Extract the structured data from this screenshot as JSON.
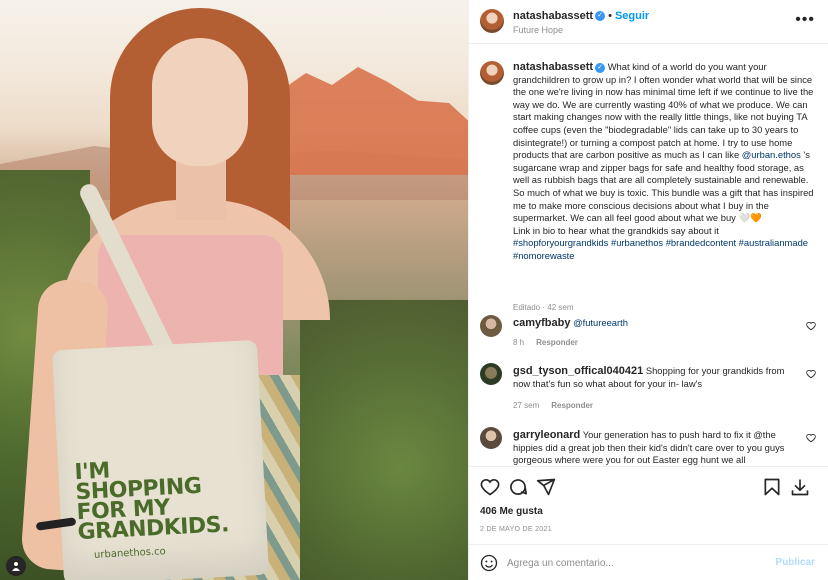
{
  "post": {
    "username": "natashabassett",
    "verified_mark": "✓",
    "follow_label": "Seguir",
    "location": "Future Hope",
    "more_label": "•••"
  },
  "photo": {
    "bag_lines": [
      "I'M",
      "SHOPPING",
      "FOR MY",
      "GRANDKIDS."
    ],
    "bag_brand": "urbanethos.co",
    "corner_icon": "user-tag-icon"
  },
  "caption": {
    "username": "natashabassett",
    "text_1": "What kind of a world do you want your grandchildren to grow up in? I often wonder what world that will be since the one we're living in now has minimal time left if we continue to live the way we do. We are currently wasting 40% of what we produce. We can start making changes now with the really little things, like not buying TA coffee cups (even the \"biodegradable\" lids can take up to 30 years to disintegrate!) or turning a compost patch at home. I try to use home products that are carbon positive as much as I can like ",
    "mention": "@urban.ethos",
    "text_2": " 's sugarcane wrap and zipper bags for safe and healthy food storage, as well as rubbish bags that are all completely sustainable and renewable. So much of what we buy is toxic. This bundle was a gift that has inspired me to make more conscious decisions about what I buy in the supermarket. We can all feel good about what we buy ",
    "emoji": "🤍🧡",
    "text_3": " Link in bio to hear what the grandkids say about it",
    "hashtags": "#shopforyourgrandkids #urbanethos #brandedcontent #australianmade #nomorewaste",
    "meta": "Editado · 42 sem"
  },
  "comments": [
    {
      "username": "camyfbaby",
      "text": "@futureearth",
      "time": "8 h",
      "reply": "Responder"
    },
    {
      "username": "gsd_tyson_offical040421",
      "text": "Shopping for your grandkids from now that's fun so what about for your in- law's",
      "time": "27 sem",
      "reply": "Responder"
    },
    {
      "username": "garryleonard",
      "text": "Your generation has to push hard to fix it @the hippies did a great job then their kid's didn't care over to you guys gorgeous where were you for out Easter egg hunt we all"
    }
  ],
  "actions": {
    "like_icon": "heart-icon",
    "comment_icon": "comment-icon",
    "share_icon": "share-icon",
    "save_icon": "bookmark-icon",
    "download_icon": "download-icon"
  },
  "likes": "406 Me gusta",
  "date": "2 DE MAYO DE 2021",
  "add_comment": {
    "placeholder": "Agrega un comentario...",
    "publish_label": "Publicar"
  },
  "colors": {
    "link": "#0095f6",
    "hashtag": "#00376b",
    "muted": "#8e8e8e",
    "publish_disabled": "#b3dbff"
  }
}
